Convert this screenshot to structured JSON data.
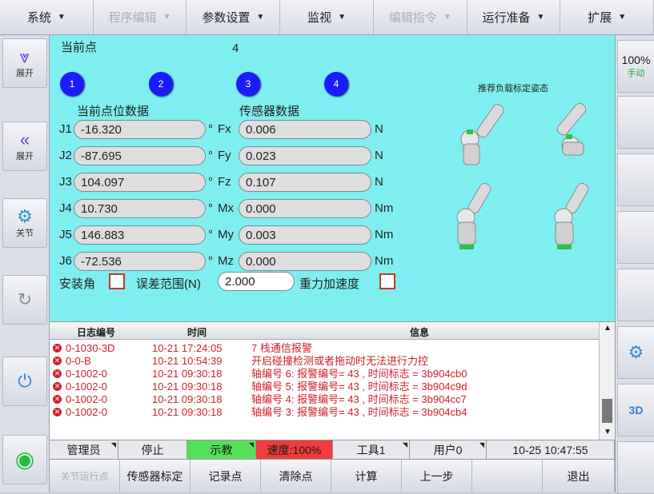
{
  "menu": [
    {
      "label": "系统",
      "disabled": false
    },
    {
      "label": "程序编辑",
      "disabled": true
    },
    {
      "label": "参数设置",
      "disabled": false
    },
    {
      "label": "监视",
      "disabled": false
    },
    {
      "label": "编辑指令",
      "disabled": true
    },
    {
      "label": "运行准备",
      "disabled": false
    },
    {
      "label": "扩展",
      "disabled": false
    }
  ],
  "left_rail": {
    "expand1": "展开",
    "expand2": "展开",
    "joint": "关节"
  },
  "right_rail": {
    "speed": "100%",
    "mode": "手动"
  },
  "main": {
    "current_point_label": "当前点",
    "current_point_value": "4",
    "points": [
      "1",
      "2",
      "3",
      "4"
    ],
    "pos_data_title": "当前点位数据",
    "sensor_data_title": "传感器数据",
    "recommend_title": "推荐负载标定姿态",
    "joints": [
      {
        "name": "J1",
        "value": "-16.320",
        "unit": "°",
        "axis": "Fx",
        "sensor": "0.006",
        "sunit": "N"
      },
      {
        "name": "J2",
        "value": "-87.695",
        "unit": "°",
        "axis": "Fy",
        "sensor": "0.023",
        "sunit": "N"
      },
      {
        "name": "J3",
        "value": "104.097",
        "unit": "°",
        "axis": "Fz",
        "sensor": "0.107",
        "sunit": "N"
      },
      {
        "name": "J4",
        "value": "10.730",
        "unit": "°",
        "axis": "Mx",
        "sensor": "0.000",
        "sunit": "Nm"
      },
      {
        "name": "J5",
        "value": "146.883",
        "unit": "°",
        "axis": "My",
        "sensor": "0.003",
        "sunit": "Nm"
      },
      {
        "name": "J6",
        "value": "-72.536",
        "unit": "°",
        "axis": "Mz",
        "sensor": "0.000",
        "sunit": "Nm"
      }
    ],
    "install_angle": "安装角",
    "error_range_label": "误差范围(N)",
    "error_range_value": "2.000",
    "gravity_label": "重力加速度"
  },
  "log": {
    "col_id": "日志编号",
    "col_time": "时间",
    "col_info": "信息",
    "rows": [
      {
        "id": "0-1030-3D",
        "time": "10-21 17:24:05",
        "info": "7 栈通信报警"
      },
      {
        "id": "0-0-B",
        "time": "10-21 10:54:39",
        "info": "开启碰撞检测或者拖动时无法进行力控"
      },
      {
        "id": "0-1002-0",
        "time": "10-21 09:30:18",
        "info": "轴编号 6: 报警编号= 43 , 时间标志 = 3b904cb0"
      },
      {
        "id": "0-1002-0",
        "time": "10-21 09:30:18",
        "info": "轴编号 5: 报警编号= 43 , 时间标志 = 3b904c9d"
      },
      {
        "id": "0-1002-0",
        "time": "10-21 09:30:18",
        "info": "轴编号 4: 报警编号= 43 , 时间标志 = 3b904cc7"
      },
      {
        "id": "0-1002-0",
        "time": "10-21 09:30:18",
        "info": "轴编号 3: 报警编号= 43 , 时间标志 = 3b904cb4"
      }
    ]
  },
  "status": {
    "user": "管理员",
    "state": "停止",
    "mode": "示教",
    "speed": "速度:100%",
    "tool": "工具1",
    "user_frame": "用户0",
    "datetime": "10-25 10:47:55"
  },
  "bottom": {
    "b1": "关节运行点",
    "b2": "传感器标定",
    "b3": "记录点",
    "b4": "清除点",
    "b5": "计算",
    "b6": "上一步",
    "b7": "",
    "b8": "退出"
  },
  "colors": {
    "panel": "#7feef0",
    "point_circle": "#1b1bff",
    "log_error": "#d0202a",
    "mode_green": "#55e05a",
    "speed_red": "#f03c3c"
  }
}
